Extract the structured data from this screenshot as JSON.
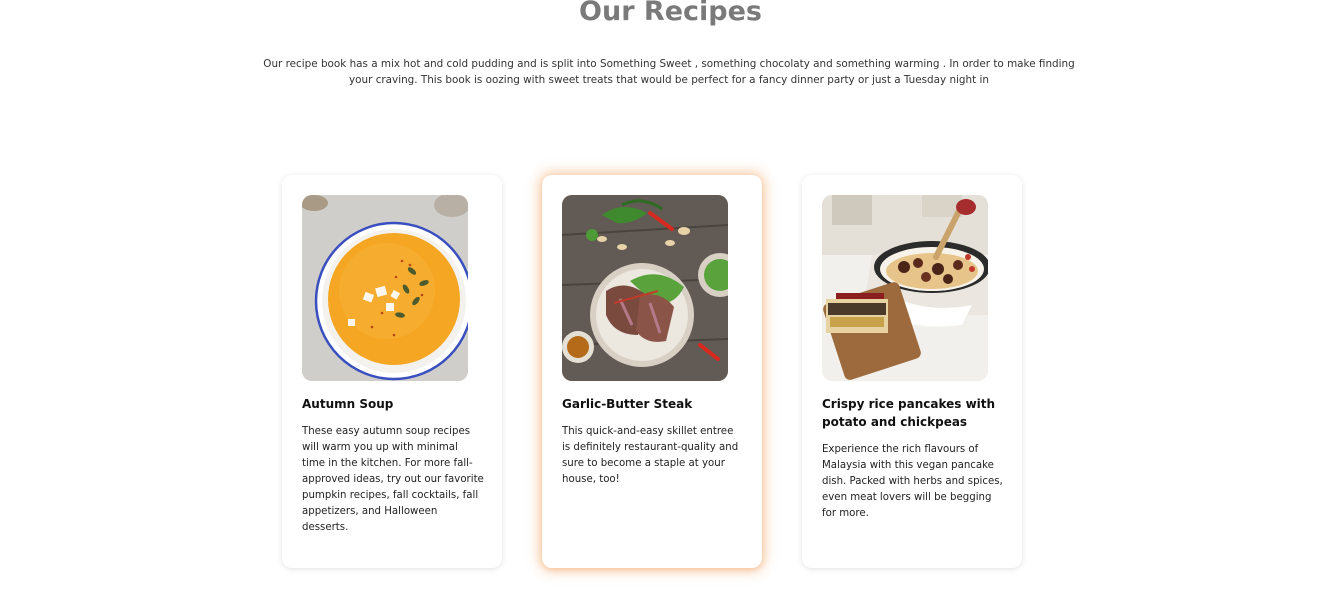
{
  "page": {
    "title": "Our Recipes",
    "intro": "Our recipe book has a mix hot and cold pudding and is split into Something Sweet , something chocolaty and something warming . In order to make finding your craving. This book is oozing with sweet treats that would be perfect for a fancy dinner party or just a Tuesday night in"
  },
  "colors": {
    "title": "#7a7a7a",
    "highlight_glow": "#f4a460"
  },
  "cards": [
    {
      "title": "Autumn Soup",
      "description": "These easy autumn soup recipes will warm you up with minimal time in the kitchen. For more fall-approved ideas, try out our favorite pumpkin recipes, fall cocktails, fall appetizers, and Halloween desserts.",
      "image": "pumpkin-soup-bowl",
      "highlighted": false
    },
    {
      "title": "Garlic-Butter Steak",
      "description": "This quick-and-easy skillet entree is definitely restaurant-quality and sure to become a staple at your house, too!",
      "image": "steak-plate",
      "highlighted": true
    },
    {
      "title": "Crispy rice pancakes with potato and chickpeas",
      "description": "Experience the rich flavours of Malaysia with this vegan pancake dish. Packed with herbs and spices, even meat lovers will be begging for more.",
      "image": "skillet-pancakes",
      "highlighted": false
    }
  ]
}
